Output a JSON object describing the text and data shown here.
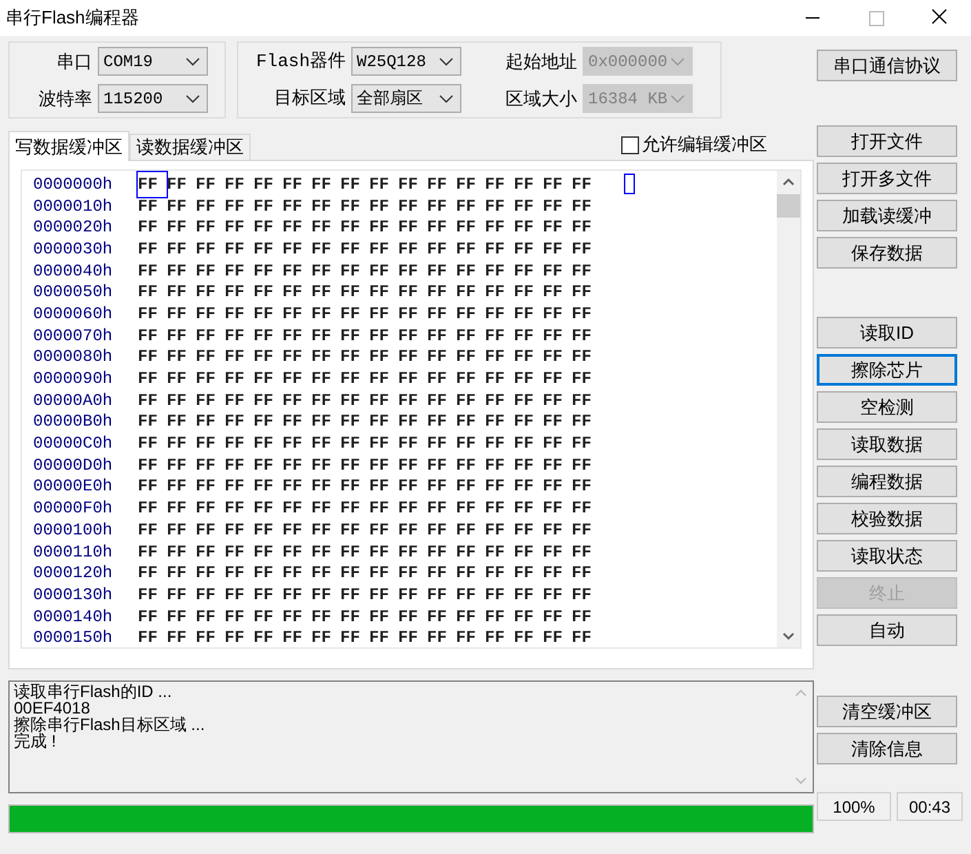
{
  "window": {
    "title": "串行Flash编程器"
  },
  "port_group": [
    {
      "label": "串口",
      "value": "COM19",
      "disabled": false
    },
    {
      "label": "波特率",
      "value": "115200",
      "disabled": false
    }
  ],
  "flash_group": [
    {
      "label": "Flash器件",
      "value": "W25Q128",
      "disabled": false
    },
    {
      "label": "起始地址",
      "value": "0x000000",
      "disabled": true
    },
    {
      "label": "目标区域",
      "value": "全部扇区",
      "disabled": false
    },
    {
      "label": "区域大小",
      "value": "16384 KB",
      "disabled": true
    }
  ],
  "protocol_button": {
    "label": "串口通信协议",
    "focused": false,
    "disabled": false
  },
  "tabs": [
    {
      "label": "写数据缓冲区",
      "selected": true
    },
    {
      "label": "读数据缓冲区",
      "selected": false
    }
  ],
  "allow_edit": {
    "label": "允许编辑缓冲区",
    "checked": false
  },
  "hex_rows": [
    {
      "address": "0000000h",
      "bytes": [
        "FF",
        "FF",
        "FF",
        "FF",
        "FF",
        "FF",
        "FF",
        "FF",
        "FF",
        "FF",
        "FF",
        "FF",
        "FF",
        "FF",
        "FF",
        "FF"
      ],
      "cursor": true
    },
    {
      "address": "0000010h",
      "bytes": [
        "FF",
        "FF",
        "FF",
        "FF",
        "FF",
        "FF",
        "FF",
        "FF",
        "FF",
        "FF",
        "FF",
        "FF",
        "FF",
        "FF",
        "FF",
        "FF"
      ]
    },
    {
      "address": "0000020h",
      "bytes": [
        "FF",
        "FF",
        "FF",
        "FF",
        "FF",
        "FF",
        "FF",
        "FF",
        "FF",
        "FF",
        "FF",
        "FF",
        "FF",
        "FF",
        "FF",
        "FF"
      ]
    },
    {
      "address": "0000030h",
      "bytes": [
        "FF",
        "FF",
        "FF",
        "FF",
        "FF",
        "FF",
        "FF",
        "FF",
        "FF",
        "FF",
        "FF",
        "FF",
        "FF",
        "FF",
        "FF",
        "FF"
      ]
    },
    {
      "address": "0000040h",
      "bytes": [
        "FF",
        "FF",
        "FF",
        "FF",
        "FF",
        "FF",
        "FF",
        "FF",
        "FF",
        "FF",
        "FF",
        "FF",
        "FF",
        "FF",
        "FF",
        "FF"
      ]
    },
    {
      "address": "0000050h",
      "bytes": [
        "FF",
        "FF",
        "FF",
        "FF",
        "FF",
        "FF",
        "FF",
        "FF",
        "FF",
        "FF",
        "FF",
        "FF",
        "FF",
        "FF",
        "FF",
        "FF"
      ]
    },
    {
      "address": "0000060h",
      "bytes": [
        "FF",
        "FF",
        "FF",
        "FF",
        "FF",
        "FF",
        "FF",
        "FF",
        "FF",
        "FF",
        "FF",
        "FF",
        "FF",
        "FF",
        "FF",
        "FF"
      ]
    },
    {
      "address": "0000070h",
      "bytes": [
        "FF",
        "FF",
        "FF",
        "FF",
        "FF",
        "FF",
        "FF",
        "FF",
        "FF",
        "FF",
        "FF",
        "FF",
        "FF",
        "FF",
        "FF",
        "FF"
      ]
    },
    {
      "address": "0000080h",
      "bytes": [
        "FF",
        "FF",
        "FF",
        "FF",
        "FF",
        "FF",
        "FF",
        "FF",
        "FF",
        "FF",
        "FF",
        "FF",
        "FF",
        "FF",
        "FF",
        "FF"
      ]
    },
    {
      "address": "0000090h",
      "bytes": [
        "FF",
        "FF",
        "FF",
        "FF",
        "FF",
        "FF",
        "FF",
        "FF",
        "FF",
        "FF",
        "FF",
        "FF",
        "FF",
        "FF",
        "FF",
        "FF"
      ]
    },
    {
      "address": "00000A0h",
      "bytes": [
        "FF",
        "FF",
        "FF",
        "FF",
        "FF",
        "FF",
        "FF",
        "FF",
        "FF",
        "FF",
        "FF",
        "FF",
        "FF",
        "FF",
        "FF",
        "FF"
      ]
    },
    {
      "address": "00000B0h",
      "bytes": [
        "FF",
        "FF",
        "FF",
        "FF",
        "FF",
        "FF",
        "FF",
        "FF",
        "FF",
        "FF",
        "FF",
        "FF",
        "FF",
        "FF",
        "FF",
        "FF"
      ]
    },
    {
      "address": "00000C0h",
      "bytes": [
        "FF",
        "FF",
        "FF",
        "FF",
        "FF",
        "FF",
        "FF",
        "FF",
        "FF",
        "FF",
        "FF",
        "FF",
        "FF",
        "FF",
        "FF",
        "FF"
      ]
    },
    {
      "address": "00000D0h",
      "bytes": [
        "FF",
        "FF",
        "FF",
        "FF",
        "FF",
        "FF",
        "FF",
        "FF",
        "FF",
        "FF",
        "FF",
        "FF",
        "FF",
        "FF",
        "FF",
        "FF"
      ]
    },
    {
      "address": "00000E0h",
      "bytes": [
        "FF",
        "FF",
        "FF",
        "FF",
        "FF",
        "FF",
        "FF",
        "FF",
        "FF",
        "FF",
        "FF",
        "FF",
        "FF",
        "FF",
        "FF",
        "FF"
      ]
    },
    {
      "address": "00000F0h",
      "bytes": [
        "FF",
        "FF",
        "FF",
        "FF",
        "FF",
        "FF",
        "FF",
        "FF",
        "FF",
        "FF",
        "FF",
        "FF",
        "FF",
        "FF",
        "FF",
        "FF"
      ]
    },
    {
      "address": "0000100h",
      "bytes": [
        "FF",
        "FF",
        "FF",
        "FF",
        "FF",
        "FF",
        "FF",
        "FF",
        "FF",
        "FF",
        "FF",
        "FF",
        "FF",
        "FF",
        "FF",
        "FF"
      ]
    },
    {
      "address": "0000110h",
      "bytes": [
        "FF",
        "FF",
        "FF",
        "FF",
        "FF",
        "FF",
        "FF",
        "FF",
        "FF",
        "FF",
        "FF",
        "FF",
        "FF",
        "FF",
        "FF",
        "FF"
      ]
    },
    {
      "address": "0000120h",
      "bytes": [
        "FF",
        "FF",
        "FF",
        "FF",
        "FF",
        "FF",
        "FF",
        "FF",
        "FF",
        "FF",
        "FF",
        "FF",
        "FF",
        "FF",
        "FF",
        "FF"
      ]
    },
    {
      "address": "0000130h",
      "bytes": [
        "FF",
        "FF",
        "FF",
        "FF",
        "FF",
        "FF",
        "FF",
        "FF",
        "FF",
        "FF",
        "FF",
        "FF",
        "FF",
        "FF",
        "FF",
        "FF"
      ]
    },
    {
      "address": "0000140h",
      "bytes": [
        "FF",
        "FF",
        "FF",
        "FF",
        "FF",
        "FF",
        "FF",
        "FF",
        "FF",
        "FF",
        "FF",
        "FF",
        "FF",
        "FF",
        "FF",
        "FF"
      ]
    },
    {
      "address": "0000150h",
      "bytes": [
        "FF",
        "FF",
        "FF",
        "FF",
        "FF",
        "FF",
        "FF",
        "FF",
        "FF",
        "FF",
        "FF",
        "FF",
        "FF",
        "FF",
        "FF",
        "FF"
      ]
    }
  ],
  "button_groups": [
    [
      {
        "label": "打开文件",
        "focused": false,
        "disabled": false
      },
      {
        "label": "打开多文件",
        "focused": false,
        "disabled": false
      },
      {
        "label": "加载读缓冲",
        "focused": false,
        "disabled": false
      },
      {
        "label": "保存数据",
        "focused": false,
        "disabled": false
      }
    ],
    [
      {
        "label": "读取ID",
        "focused": false,
        "disabled": false
      },
      {
        "label": "擦除芯片",
        "focused": true,
        "disabled": false
      },
      {
        "label": "空检测",
        "focused": false,
        "disabled": false
      },
      {
        "label": "读取数据",
        "focused": false,
        "disabled": false
      },
      {
        "label": "编程数据",
        "focused": false,
        "disabled": false
      },
      {
        "label": "校验数据",
        "focused": false,
        "disabled": false
      },
      {
        "label": "读取状态",
        "focused": false,
        "disabled": false
      },
      {
        "label": "终止",
        "focused": false,
        "disabled": true
      },
      {
        "label": "自动",
        "focused": false,
        "disabled": false
      }
    ],
    [
      {
        "label": "清空缓冲区",
        "focused": false,
        "disabled": false
      },
      {
        "label": "清除信息",
        "focused": false,
        "disabled": false
      }
    ]
  ],
  "log": [
    "读取串行Flash的ID ...",
    "00EF4018",
    "擦除串行Flash目标区域 ...",
    "完成 !"
  ],
  "progress": {
    "level": 1
  },
  "progress_text": "100%",
  "elapsed": "00:43"
}
